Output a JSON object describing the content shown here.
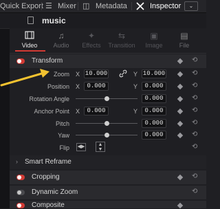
{
  "toolbar": {
    "quick_export": "Quick Export",
    "mixer": "Mixer",
    "metadata": "Metadata",
    "inspector": "Inspector",
    "dropdown_icon": "chevron-down-icon"
  },
  "title": "music",
  "tabs": [
    {
      "label": "Video",
      "icon": "film-icon",
      "state": "active"
    },
    {
      "label": "Audio",
      "icon": "music-note-icon",
      "state": "normal"
    },
    {
      "label": "Effects",
      "icon": "magic-wand-icon",
      "state": "dim"
    },
    {
      "label": "Transition",
      "icon": "transition-icon",
      "state": "dim"
    },
    {
      "label": "Image",
      "icon": "image-icon",
      "state": "dim"
    },
    {
      "label": "File",
      "icon": "file-icon",
      "state": "normal"
    }
  ],
  "transform": {
    "label": "Transform",
    "zoom": {
      "label": "Zoom",
      "x_axis": "X",
      "y_axis": "Y",
      "x": "10.000",
      "y": "10.000"
    },
    "position": {
      "label": "Position",
      "x_axis": "X",
      "y_axis": "Y",
      "x": "0.000",
      "y": "0.000"
    },
    "rotation_angle": {
      "label": "Rotation Angle",
      "value": "0.000",
      "slider": 0.5
    },
    "anchor_point": {
      "label": "Anchor Point",
      "x_axis": "X",
      "y_axis": "Y",
      "x": "0.000",
      "y": "0.000"
    },
    "pitch": {
      "label": "Pitch",
      "value": "0.000",
      "slider": 0.5
    },
    "yaw": {
      "label": "Yaw",
      "value": "0.000",
      "slider": 0.5
    },
    "flip": {
      "label": "Flip"
    }
  },
  "sections": {
    "smart_reframe": "Smart Reframe",
    "cropping": "Cropping",
    "dynamic_zoom": "Dynamic Zoom",
    "composite": "Composite"
  },
  "colors": {
    "accent": "#d23b35",
    "annotation_arrow": "#f2c230"
  }
}
